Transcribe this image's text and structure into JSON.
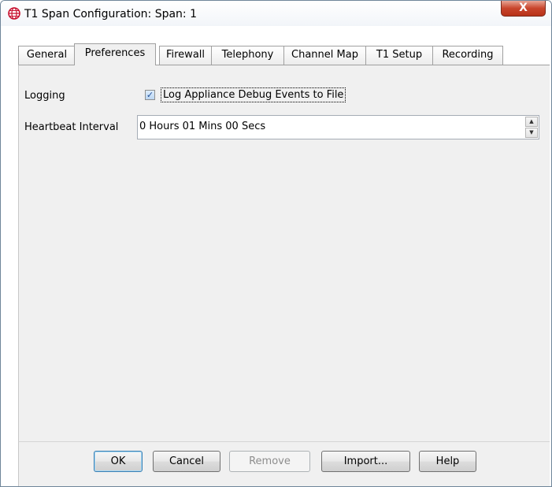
{
  "window": {
    "title": "T1 Span Configuration: Span: 1",
    "close_label": "X"
  },
  "tabs": [
    {
      "label": "General",
      "active": false
    },
    {
      "label": "Preferences",
      "active": true
    },
    {
      "label": "Firewall",
      "active": false
    },
    {
      "label": "Telephony",
      "active": false
    },
    {
      "label": "Channel Map",
      "active": false
    },
    {
      "label": "T1 Setup",
      "active": false
    },
    {
      "label": "Recording",
      "active": false
    }
  ],
  "preferences": {
    "logging_label": "Logging",
    "debug_checkbox": {
      "label": "Log Appliance Debug Events to File",
      "checked": true,
      "checkmark": "✓"
    },
    "heartbeat_label": "Heartbeat Interval",
    "heartbeat_value": "0 Hours 01 Mins 00 Secs"
  },
  "buttons": {
    "ok": "OK",
    "cancel": "Cancel",
    "remove": "Remove",
    "import": "Import...",
    "help": "Help"
  },
  "icons": {
    "app": "globe-logo-icon",
    "spin_up": "▲",
    "spin_down": "▼"
  },
  "colors": {
    "panel": "#f0f0f0",
    "close_button": "#c8452c",
    "default_button_border": "#3c7fb1",
    "logo_red": "#c8102e"
  }
}
